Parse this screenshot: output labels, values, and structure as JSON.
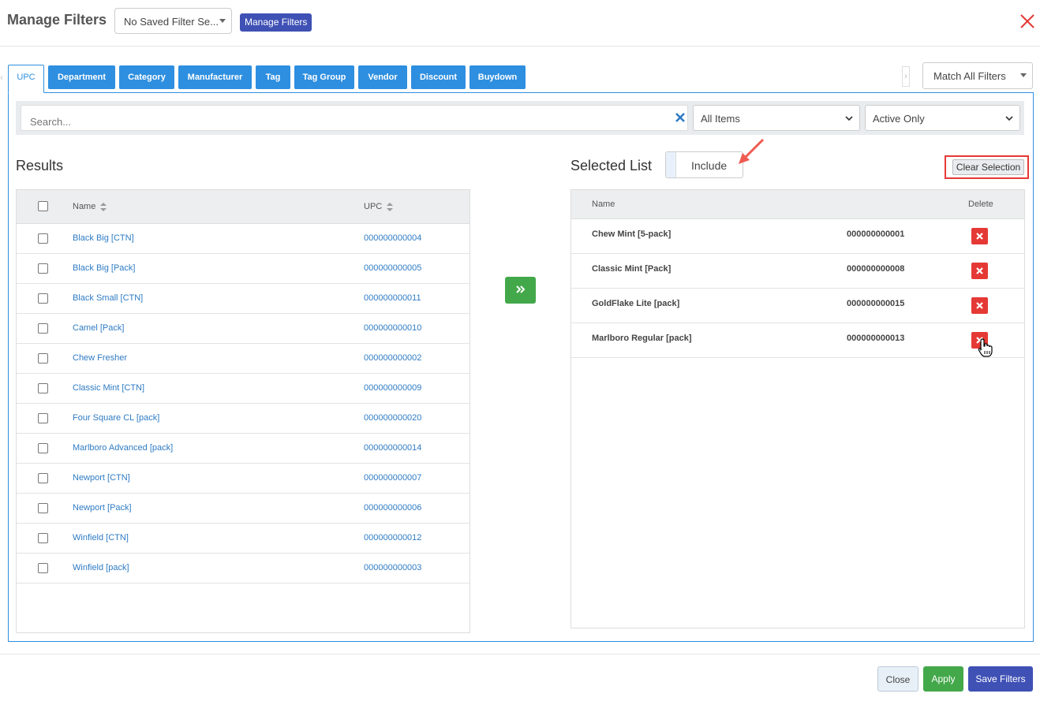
{
  "header": {
    "title": "Manage Filters",
    "saved_filter_value": "No Saved Filter Se...",
    "manage_button": "Manage Filters"
  },
  "tabs": [
    {
      "label": "UPC",
      "active": true
    },
    {
      "label": "Department"
    },
    {
      "label": "Category"
    },
    {
      "label": "Manufacturer"
    },
    {
      "label": "Tag"
    },
    {
      "label": "Tag Group"
    },
    {
      "label": "Vendor"
    },
    {
      "label": "Discount"
    },
    {
      "label": "Buydown"
    }
  ],
  "match_select": "Match All Filters",
  "search": {
    "placeholder": "Search...",
    "items_filter": "All Items",
    "status_filter": "Active Only"
  },
  "results": {
    "title": "Results",
    "col_name": "Name",
    "col_upc": "UPC",
    "rows": [
      {
        "name": "Black Big [CTN]",
        "upc": "000000000004"
      },
      {
        "name": "Black Big [Pack]",
        "upc": "000000000005"
      },
      {
        "name": "Black Small [CTN]",
        "upc": "000000000011"
      },
      {
        "name": "Camel [Pack]",
        "upc": "000000000010"
      },
      {
        "name": "Chew Fresher",
        "upc": "000000000002"
      },
      {
        "name": "Classic Mint [CTN]",
        "upc": "000000000009"
      },
      {
        "name": "Four Square CL [pack]",
        "upc": "000000000020"
      },
      {
        "name": "Marlboro Advanced [pack]",
        "upc": "000000000014"
      },
      {
        "name": "Newport [CTN]",
        "upc": "000000000007"
      },
      {
        "name": "Newport [Pack]",
        "upc": "000000000006"
      },
      {
        "name": "Winfield [CTN]",
        "upc": "000000000012"
      },
      {
        "name": "Winfield [pack]",
        "upc": "000000000003"
      }
    ]
  },
  "selected": {
    "title": "Selected List",
    "mode": "Include",
    "clear_button": "Clear Selection",
    "col_name": "Name",
    "col_delete": "Delete",
    "rows": [
      {
        "name": "Chew Mint [5-pack]",
        "upc": "000000000001"
      },
      {
        "name": "Classic Mint [Pack]",
        "upc": "000000000008"
      },
      {
        "name": "GoldFlake Lite [pack]",
        "upc": "000000000015"
      },
      {
        "name": "Marlboro Regular [pack]",
        "upc": "000000000013"
      }
    ]
  },
  "footer": {
    "close": "Close",
    "apply": "Apply",
    "save": "Save Filters"
  },
  "colors": {
    "primary": "#3f51b5",
    "tab_blue": "#2e8fe0",
    "success": "#43a84a",
    "danger": "#e53935",
    "link": "#2e7bc4"
  }
}
